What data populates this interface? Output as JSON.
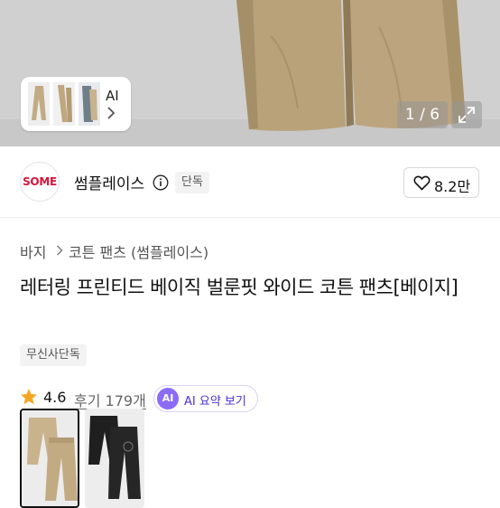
{
  "gallery": {
    "ai_label": "AI",
    "counter": "1 / 6"
  },
  "brand": {
    "logo_text": "SOME",
    "name": "썸플레이스",
    "badge": "단독",
    "likes": "8.2만"
  },
  "breadcrumb": [
    "바지",
    "코튼 팬츠 (썸플레이스)"
  ],
  "product": {
    "title": "레터링 프린티드 베이직 벌룬핏 와이드 코튼 팬츠[베이지]",
    "tag": "무신사단독",
    "rating": "4.6",
    "reviews": "후기 179개",
    "ai_summary": "AI 요약 보기",
    "ai_icon": "AI"
  },
  "variants": [
    {
      "name": "beige",
      "color": "#c9b38d",
      "selected": true
    },
    {
      "name": "black",
      "color": "#1e1e1e",
      "selected": false
    }
  ],
  "colors": {
    "brand_red": "#d6143a",
    "ai_purple": "#8b6cf6",
    "star": "#f5a623"
  }
}
